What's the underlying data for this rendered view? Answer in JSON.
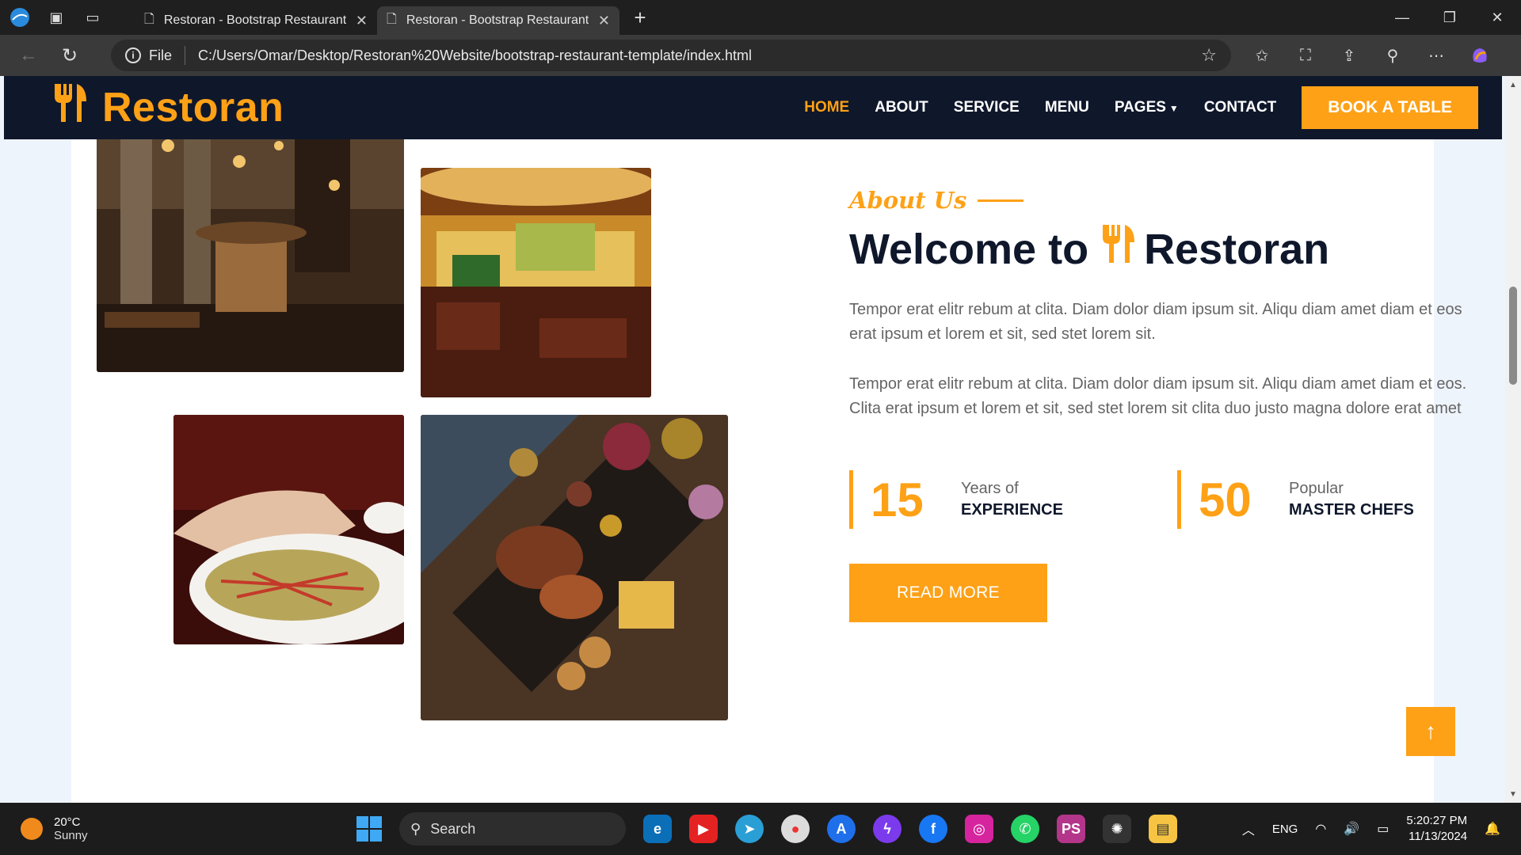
{
  "browser": {
    "tabs": [
      {
        "title": "Restoran - Bootstrap Restaurant T",
        "active": false
      },
      {
        "title": "Restoran - Bootstrap Restaurant T",
        "active": true
      }
    ],
    "address": {
      "scheme_label": "File",
      "url": "C:/Users/Omar/Desktop/Restoran%20Website/bootstrap-restaurant-template/index.html"
    }
  },
  "site": {
    "brand": "Restoran",
    "nav": [
      {
        "label": "HOME",
        "active": true
      },
      {
        "label": "ABOUT"
      },
      {
        "label": "SERVICE"
      },
      {
        "label": "MENU"
      },
      {
        "label": "PAGES"
      },
      {
        "label": "CONTACT"
      }
    ],
    "cta": "BOOK A TABLE",
    "accent_color": "#fea116",
    "dark_color": "#0f172b"
  },
  "about": {
    "kicker": "About Us",
    "heading_pre": "Welcome to",
    "heading_brand": "Restoran",
    "para1": "Tempor erat elitr rebum at clita. Diam dolor diam ipsum sit. Aliqu diam amet diam et eos erat ipsum et lorem et sit, sed stet lorem sit.",
    "para2": "Tempor erat elitr rebum at clita. Diam dolor diam ipsum sit. Aliqu diam amet diam et eos. Clita erat ipsum et lorem et sit, sed stet lorem sit clita duo justo magna dolore erat amet",
    "stats": [
      {
        "number": "15",
        "small": "Years of",
        "big": "EXPERIENCE"
      },
      {
        "number": "50",
        "small": "Popular",
        "big": "MASTER CHEFS"
      }
    ],
    "button": "READ MORE"
  },
  "taskbar": {
    "weather_temp": "20°C",
    "weather_desc": "Sunny",
    "search_placeholder": "Search",
    "language": "ENG",
    "time": "5:20:27 PM",
    "date": "11/13/2024"
  }
}
